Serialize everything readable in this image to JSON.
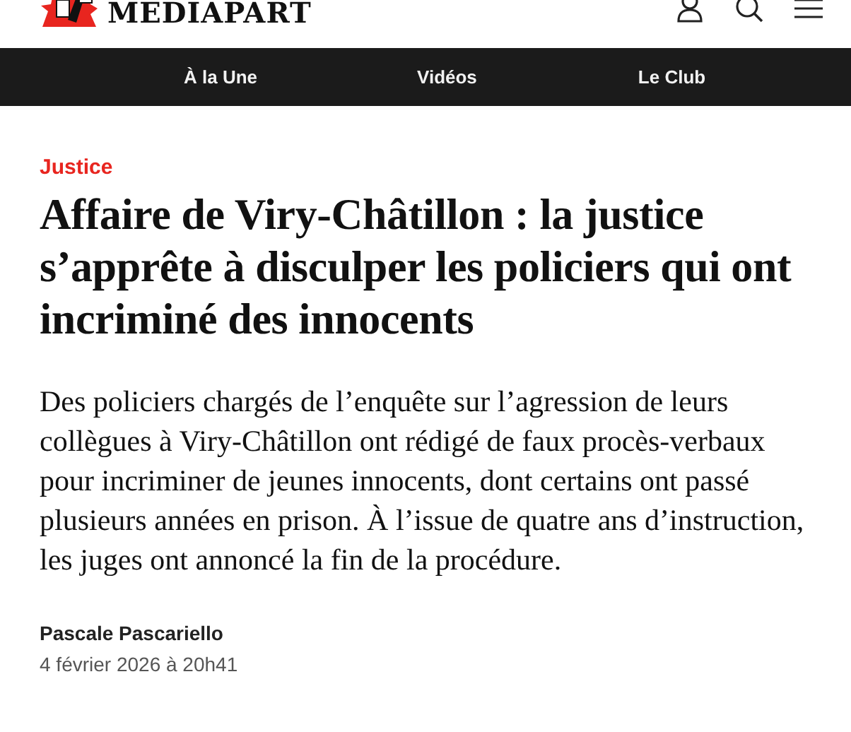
{
  "header": {
    "logo": "MEDIAPART"
  },
  "nav": [
    {
      "label": "À la Une"
    },
    {
      "label": "Vidéos"
    },
    {
      "label": "Le Club"
    }
  ],
  "article": {
    "section": "Justice",
    "title": "Affaire de Viry-Châtillon : la justice s’apprête à disculper les policiers qui ont incriminé des innocents",
    "lead": "Des policiers chargés de l’enquête sur l’agression de leurs collègues à Viry-Châtillon ont rédigé de faux procès-verbaux pour incriminer de jeunes innocents, dont certains ont passé plusieurs années en prison. À l’issue de quatre ans d’instruction, les juges ont annoncé la fin de la procédure.",
    "author": "Pascale Pascariello",
    "date": "4 février 2026 à 20h41"
  }
}
